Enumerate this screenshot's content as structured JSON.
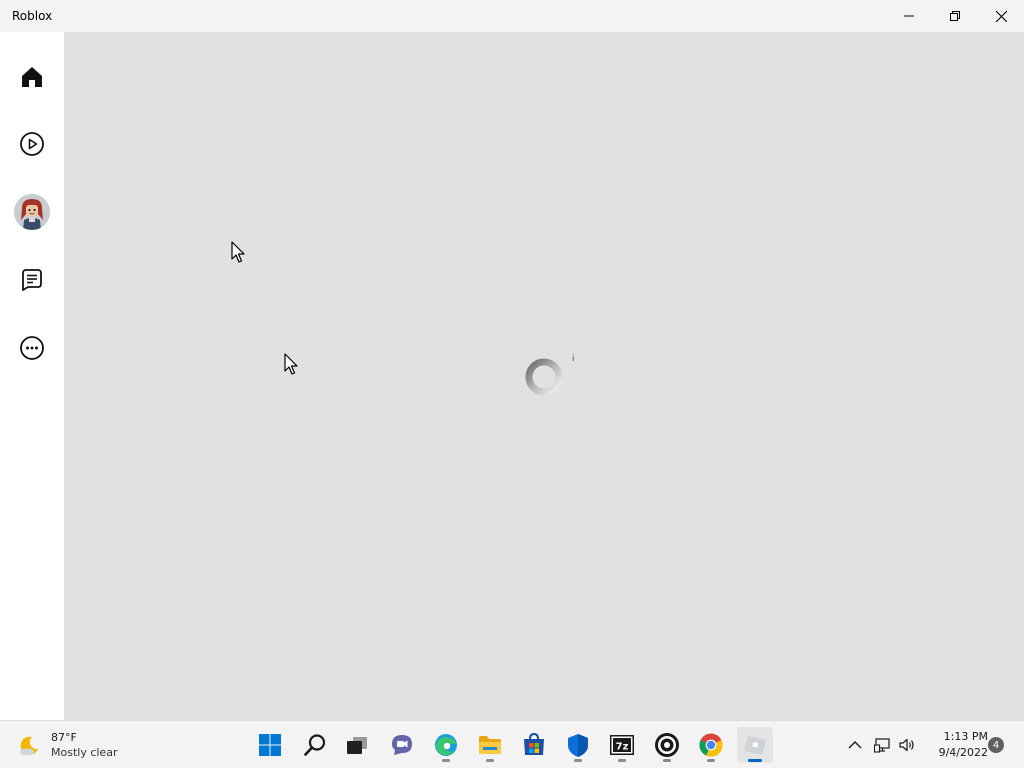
{
  "window": {
    "title": "Roblox",
    "controls": {
      "minimize": "minimize",
      "maximize": "restore",
      "close": "close"
    }
  },
  "sidebar": {
    "items": [
      {
        "name": "home",
        "icon": "home-icon"
      },
      {
        "name": "play",
        "icon": "play-icon"
      },
      {
        "name": "avatar",
        "icon": "avatar-icon"
      },
      {
        "name": "chat",
        "icon": "chat-icon"
      },
      {
        "name": "more",
        "icon": "more-icon"
      }
    ]
  },
  "main": {
    "loading": true,
    "spinner_mark": "i"
  },
  "taskbar": {
    "weather": {
      "temp": "87°F",
      "desc": "Mostly clear",
      "icon": "moon-cloud-icon"
    },
    "apps": [
      {
        "name": "start",
        "icon": "windows-start-icon"
      },
      {
        "name": "search",
        "icon": "search-icon"
      },
      {
        "name": "task-view",
        "icon": "task-view-icon"
      },
      {
        "name": "teams-chat",
        "icon": "teams-chat-icon"
      },
      {
        "name": "edge",
        "icon": "edge-icon",
        "running": true
      },
      {
        "name": "file-explorer",
        "icon": "folder-icon",
        "running": true
      },
      {
        "name": "microsoft-store",
        "icon": "store-icon"
      },
      {
        "name": "security",
        "icon": "shield-icon",
        "running": true
      },
      {
        "name": "7zip",
        "icon": "7zip-icon",
        "running": true
      },
      {
        "name": "obs",
        "icon": "obs-icon",
        "running": true
      },
      {
        "name": "chrome",
        "icon": "chrome-icon",
        "running": true
      },
      {
        "name": "roblox",
        "icon": "roblox-icon",
        "running": true,
        "active": true
      }
    ],
    "tray": {
      "time": "1:13 PM",
      "date": "9/4/2022",
      "notification_count": "4"
    }
  },
  "colors": {
    "accent": "#0067c0",
    "main_bg": "#e1e1e1",
    "sidebar_bg": "#ffffff",
    "titlebar_bg": "#f3f3f3"
  }
}
